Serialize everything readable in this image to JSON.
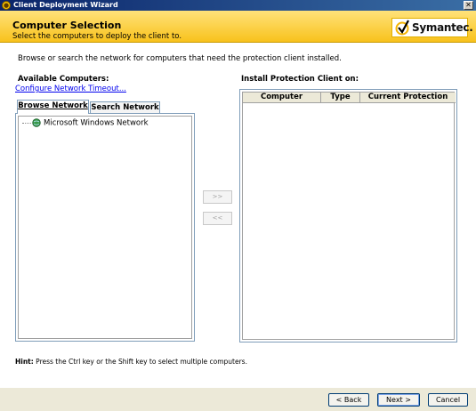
{
  "window": {
    "title": "Client Deployment Wizard",
    "close_glyph": "✕"
  },
  "header": {
    "title": "Computer Selection",
    "subtitle": "Select the computers to deploy the client to.",
    "brand": "Symantec."
  },
  "main": {
    "instructions": "Browse or search the network for computers that need the protection client installed.",
    "available_label": "Available Computers:",
    "timeout_link": "Configure Network Timeout...",
    "install_label": "Install Protection Client on:",
    "tabs": [
      {
        "label": "Browse Network",
        "active": true
      },
      {
        "label": "Search Network",
        "active": false
      }
    ],
    "tree_items": [
      {
        "label": "Microsoft Windows Network",
        "icon": "network-globe-icon"
      }
    ],
    "add_button": ">>",
    "remove_button": "<<",
    "columns": [
      "Computer",
      "Type",
      "Current Protection"
    ],
    "rows": [],
    "hint_label": "Hint:",
    "hint_text": "Press the Ctrl key or the Shift key to select multiple computers."
  },
  "footer": {
    "back": "< Back",
    "next": "Next >",
    "cancel": "Cancel"
  },
  "colors": {
    "header_gradient_top": "#ffe27a",
    "header_gradient_bottom": "#f8c21c",
    "brand_check": "#f4b400",
    "link": "#0000ee"
  }
}
